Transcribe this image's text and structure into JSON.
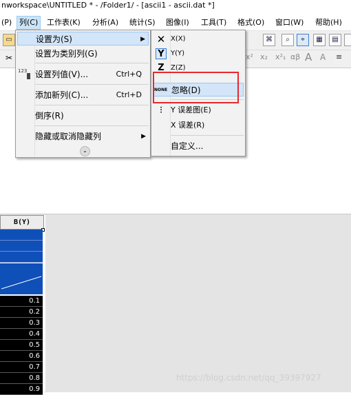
{
  "window": {
    "title": "nworkspace\\UNTITLED * - /Folder1/ - [ascii1 - ascii.dat *]"
  },
  "menubar": {
    "items": [
      {
        "label": "(P)"
      },
      {
        "label": "列(C)"
      },
      {
        "label": "工作表(K)"
      },
      {
        "label": "分析(A)"
      },
      {
        "label": "统计(S)"
      },
      {
        "label": "图像(I)"
      },
      {
        "label": "工具(T)"
      },
      {
        "label": "格式(O)"
      },
      {
        "label": "窗口(W)"
      },
      {
        "label": "帮助(H)"
      }
    ]
  },
  "format_toolbar": {
    "superscript": "x²",
    "subscript": "x₂",
    "sub_super": "x²₁",
    "greek": "αβ",
    "font_bigger": "A",
    "font_smaller": "A"
  },
  "column_menu": {
    "items": [
      {
        "label": "设置为(S)",
        "shortcut": "",
        "has_submenu": true
      },
      {
        "label": "设置为类别列(G)",
        "shortcut": ""
      },
      {
        "label": "设置列值(V)...",
        "shortcut": "Ctrl+Q"
      },
      {
        "label": "添加新列(C)...",
        "shortcut": "Ctrl+D"
      },
      {
        "label": "倒序(R)",
        "shortcut": ""
      },
      {
        "label": "隐藏或取消隐藏列",
        "shortcut": "",
        "has_submenu": true
      }
    ],
    "set_values_icon_text": "123"
  },
  "set_as_submenu": {
    "items": [
      {
        "label": "X(X)",
        "icon": "X"
      },
      {
        "label": "Y(Y)",
        "icon": "Y"
      },
      {
        "label": "Z(Z)",
        "icon": "Z"
      },
      {
        "label": "忽略(D)",
        "icon": "NONE"
      },
      {
        "label": "Y 误差图(E)",
        "icon": "error-bar"
      },
      {
        "label": "X 误差(R)",
        "icon": ""
      },
      {
        "label": "自定义...",
        "icon": ""
      }
    ]
  },
  "worksheet": {
    "column_header": "B(Y)",
    "values": [
      "0.1",
      "0.2",
      "0.3",
      "0.4",
      "0.5",
      "0.6",
      "0.7",
      "0.8",
      "0.9"
    ]
  },
  "watermark": "https://blog.csdn.net/qq_39397927",
  "colors": {
    "accent_blue": "#0f4fb8",
    "highlight": "#d3e5f8",
    "annotation_red": "#e8262d"
  }
}
